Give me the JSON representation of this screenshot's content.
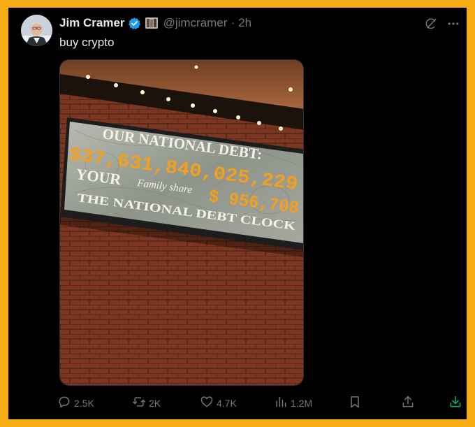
{
  "author": {
    "display_name": "Jim Cramer",
    "handle": "@jimcramer",
    "separator": "·",
    "time": "2h",
    "verified": true
  },
  "tweet": {
    "text": "buy crypto"
  },
  "media": {
    "sign_line_1": "OUR NATIONAL DEBT:",
    "debt_value": "$37,631,840,025,229",
    "sign_line_2_your": "YOUR",
    "sign_line_2_family": "Family share",
    "family_share_value": "$ 956,708",
    "sign_line_3": "THE NATIONAL DEBT CLOCK"
  },
  "actions": {
    "replies": "2.5K",
    "reposts": "2K",
    "likes": "4.7K",
    "views": "1.2M"
  },
  "colors": {
    "frame": "#f5ad13",
    "background": "#000000",
    "secondary_text": "#71767b",
    "verified": "#1d9bf0",
    "download_icon": "#00ba7c"
  },
  "icons": {
    "verified": "verified-badge-icon",
    "affiliation": "affiliate-badge-icon",
    "grok": "grok-icon",
    "more": "more-icon",
    "reply": "reply-icon",
    "repost": "repost-icon",
    "like": "heart-icon",
    "views": "views-icon",
    "bookmark": "bookmark-icon",
    "share": "share-icon",
    "download": "download-icon"
  }
}
